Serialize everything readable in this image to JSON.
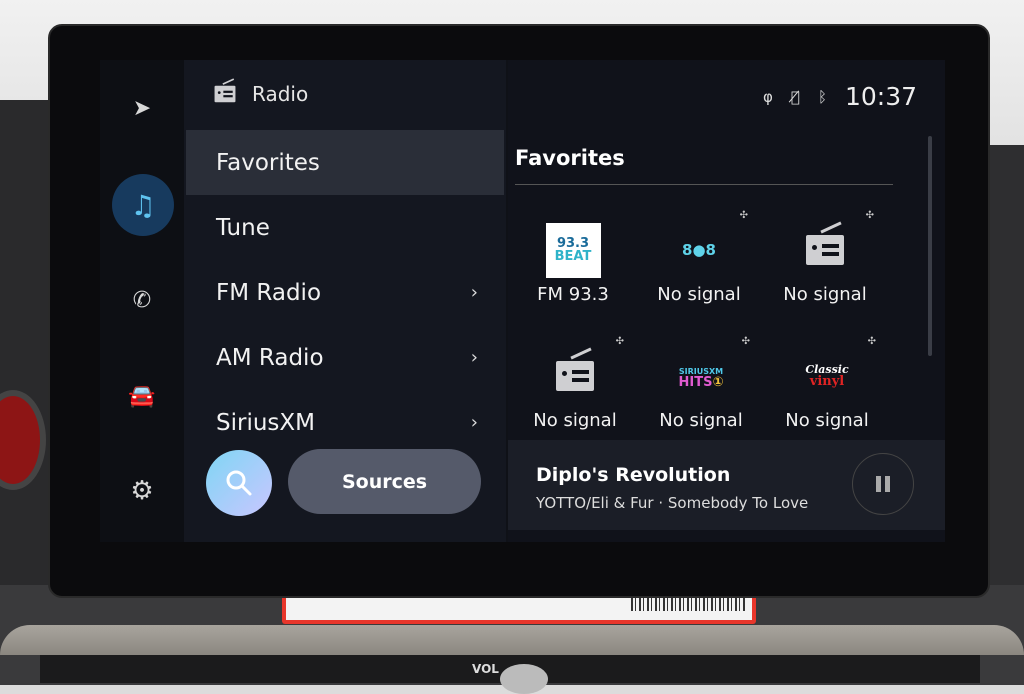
{
  "header": {
    "title": "Radio",
    "time": "10:37",
    "status_icons": [
      "wireless-charging-icon",
      "mic-muted-icon",
      "bluetooth-icon"
    ]
  },
  "rail": {
    "items": [
      {
        "icon": "navigation-icon"
      },
      {
        "icon": "music-icon",
        "active": true
      },
      {
        "icon": "phone-icon"
      },
      {
        "icon": "car-icon"
      },
      {
        "icon": "settings-icon"
      }
    ]
  },
  "menu": {
    "items": [
      {
        "label": "Favorites",
        "selected": true
      },
      {
        "label": "Tune"
      },
      {
        "label": "FM Radio",
        "chevron": true
      },
      {
        "label": "AM Radio",
        "chevron": true
      },
      {
        "label": "SiriusXM",
        "chevron": true
      }
    ],
    "sources_label": "Sources"
  },
  "favorites": {
    "title": "Favorites",
    "tiles": [
      {
        "label": "FM 93.3",
        "logo": "93.3 BEAT"
      },
      {
        "label": "No signal",
        "logo": "80s on 8",
        "badge": "SXM"
      },
      {
        "label": "No signal",
        "logo": "radio-icon",
        "badge": "SXM"
      },
      {
        "label": "No signal",
        "logo": "radio-icon",
        "badge": "SXM"
      },
      {
        "label": "No signal",
        "logo": "SiriusXM Hits 1",
        "badge": "SXM"
      },
      {
        "label": "No signal",
        "logo": "Classic vinyl",
        "badge": "SXM"
      }
    ]
  },
  "now_playing": {
    "title": "Diplo's Revolution",
    "subtitle": "YOTTO/Eli & Fur · Somebody To Love",
    "state": "playing"
  },
  "dash": {
    "vol_label": "VOL"
  },
  "colors": {
    "accent": "#5fc3f0",
    "active_bg": "#173a5e",
    "selected_row": "#2a2e38"
  }
}
